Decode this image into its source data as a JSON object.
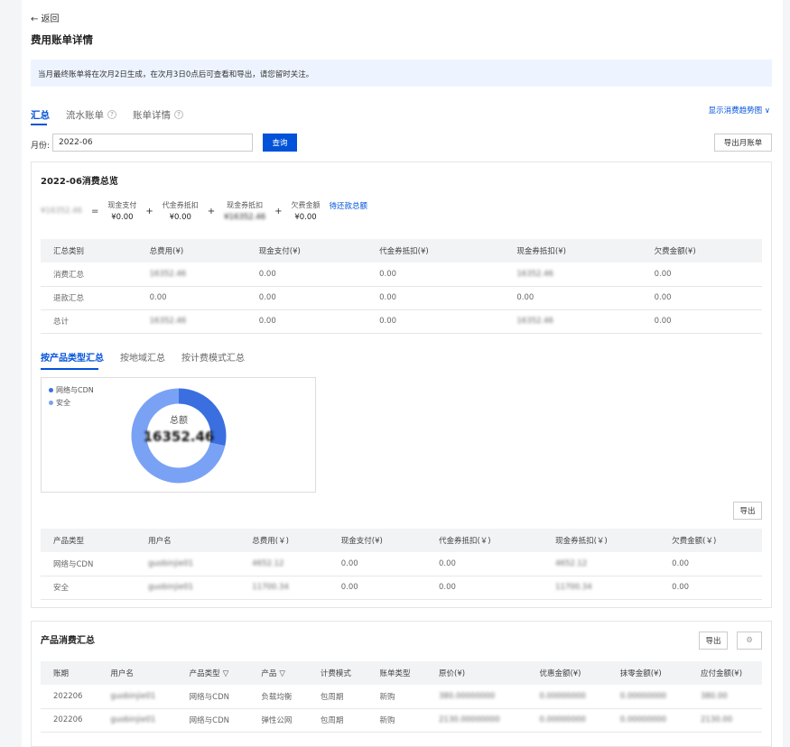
{
  "header": {
    "back_label": "← 返回",
    "title": "费用账单详情",
    "notice": "当月最终账单将在次月2日生成，在次月3日0点后可查看和导出，请您留时关注。"
  },
  "top_tabs": {
    "summary": "汇总",
    "flow": "流水账单",
    "detail": "账单详情",
    "help_icon": "?",
    "trend_link": "显示消费趋势图 ∨"
  },
  "filter": {
    "month_label": "月份:",
    "month_value": "2022-06",
    "query_button": "查询",
    "export_month_button": "导出月账单"
  },
  "overview": {
    "title": "2022-06消费总览",
    "total": "¥16352.46",
    "equals": "=",
    "plus": "+",
    "items": [
      {
        "label": "现金支付",
        "value": "¥0.00",
        "blurred": false
      },
      {
        "label": "代金券抵扣",
        "value": "¥0.00",
        "blurred": false
      },
      {
        "label": "现金券抵扣",
        "value": "¥16352.46",
        "blurred": true
      },
      {
        "label": "欠费金额",
        "value": "¥0.00",
        "blurred": false
      }
    ],
    "pending_link": "待还款总额"
  },
  "summary_table": {
    "headers": [
      "汇总类别",
      "总费用(¥)",
      "现金支付(¥)",
      "代金券抵扣(¥)",
      "现金券抵扣(¥)",
      "欠费金额(¥)"
    ],
    "rows": [
      [
        "消费汇总",
        "16352.46",
        "0.00",
        "0.00",
        "16352.46",
        "0.00"
      ],
      [
        "退款汇总",
        "0.00",
        "0.00",
        "0.00",
        "0.00",
        "0.00"
      ],
      [
        "总计",
        "16352.46",
        "0.00",
        "0.00",
        "16352.46",
        "0.00"
      ]
    ],
    "blurred_cells": [
      [
        0,
        1
      ],
      [
        0,
        4
      ],
      [
        2,
        1
      ],
      [
        2,
        4
      ]
    ]
  },
  "group_tabs": {
    "by_product": "按产品类型汇总",
    "by_region": "按地域汇总",
    "by_billing": "按计费模式汇总"
  },
  "chart_data": {
    "type": "pie",
    "categories": [
      "网络与CDN",
      "安全"
    ],
    "values": [
      4652.12,
      11700.34
    ],
    "center_label": "总额",
    "center_value": "16352.46",
    "colors": [
      "#3b6fe0",
      "#7aa2f4"
    ]
  },
  "product_type_table": {
    "export_button": "导出",
    "headers": [
      "产品类型",
      "用户名",
      "总费用(￥)",
      "现金支付(¥)",
      "代金券抵扣(￥)",
      "现金券抵扣(￥)",
      "欠费金额(￥)"
    ],
    "rows": [
      [
        "网络与CDN",
        "guobinjie01",
        "4652.12",
        "0.00",
        "0.00",
        "4652.12",
        "0.00"
      ],
      [
        "安全",
        "guobinjie01",
        "11700.34",
        "0.00",
        "0.00",
        "11700.34",
        "0.00"
      ]
    ],
    "blurred_cols": [
      1,
      2,
      5
    ]
  },
  "product_consumption": {
    "title": "产品消费汇总",
    "export_button": "导出",
    "gear_icon": "⚙",
    "filter_icon": "▽",
    "headers": [
      "账期",
      "用户名",
      "产品类型",
      "产品",
      "计费模式",
      "账单类型",
      "原价(¥)",
      "优惠金额(¥)",
      "抹零金额(¥)",
      "应付金额(¥)"
    ],
    "rows": [
      [
        "202206",
        "guobinjie01",
        "网络与CDN",
        "负载均衡",
        "包周期",
        "新购",
        "380.00000000",
        "0.00000000",
        "0.00000000",
        "380.00"
      ],
      [
        "202206",
        "guobinjie01",
        "网络与CDN",
        "弹性公网",
        "包周期",
        "新购",
        "2130.00000000",
        "0.00000000",
        "0.00000000",
        "2130.00"
      ]
    ],
    "blurred_cols": [
      1,
      6,
      7,
      8,
      9
    ]
  }
}
